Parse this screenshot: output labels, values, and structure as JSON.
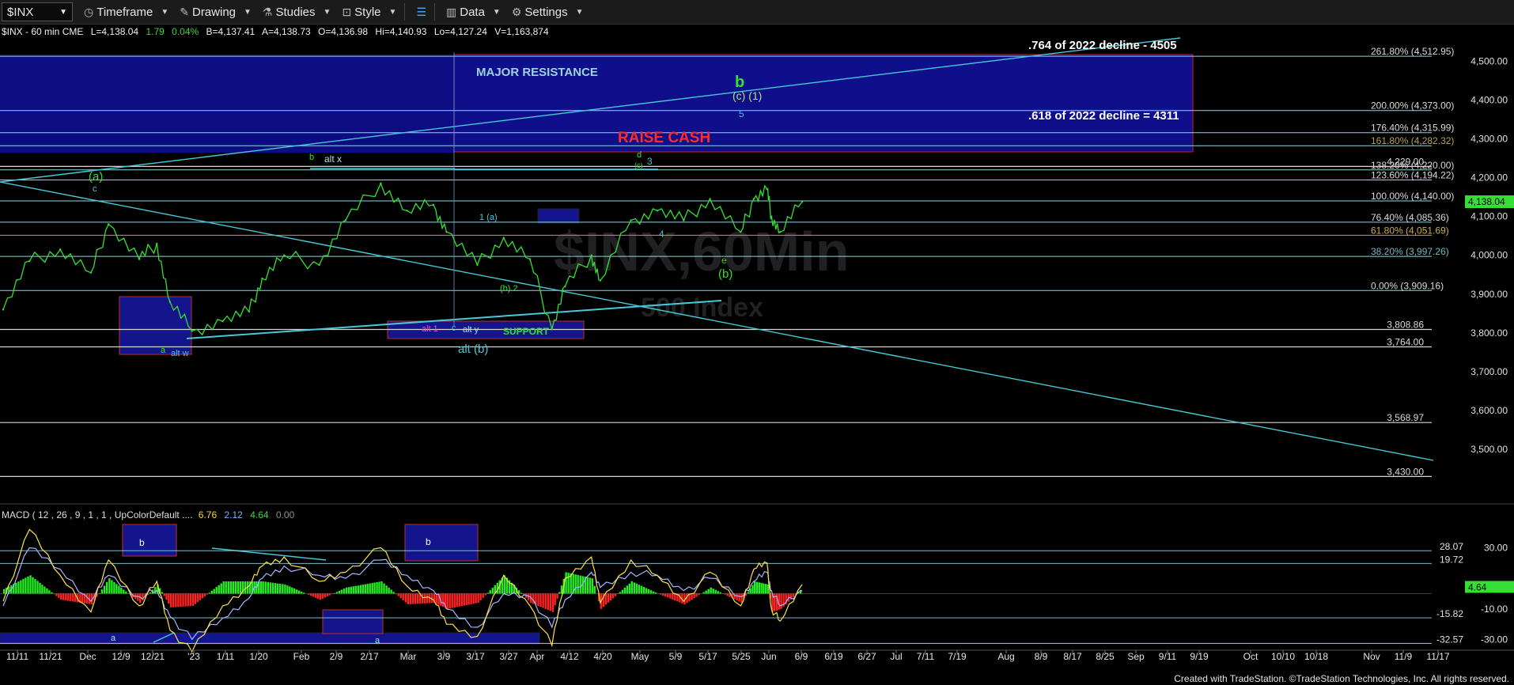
{
  "toolbar": {
    "symbol": "$INX",
    "timeframe": "Timeframe",
    "drawing": "Drawing",
    "studies": "Studies",
    "style": "Style",
    "data": "Data",
    "settings": "Settings"
  },
  "infobar": {
    "series": "$INX - 60 min CME",
    "last": "L=4,138.04",
    "change": "1.79",
    "change_pct": "0.04%",
    "bid": "B=4,137.41",
    "ask": "A=4,138.73",
    "open": "O=4,136.98",
    "high": "Hi=4,140.93",
    "low": "Lo=4,127.24",
    "volume": "V=1,163,874"
  },
  "macd_header": {
    "label": "MACD ( 12 , 26 , 9 , 1 , 1 , UpColorDefault ....",
    "v1": "6.76",
    "v2": "2.12",
    "v3": "4.64",
    "v4": "0.00"
  },
  "footer": "Created with TradeStation. ©TradeStation Technologies, Inc. All rights reserved.",
  "watermark": {
    "main": "$INX,60Min",
    "sub": "500 Index"
  },
  "colors": {
    "price_up": "#33e033",
    "macd_line": "#ffe14a",
    "signal_line": "#a8b6ff",
    "hist_up": "#22ee22",
    "hist_down": "#ff2222",
    "trendline": "#47c9d6",
    "zone": "#0f0f8c",
    "last_price_badge": "#33e033"
  },
  "chart_data": [
    {
      "type": "line",
      "title": "$INX - 60 min CME",
      "ylim": [
        3390,
        4560
      ],
      "yticks": [
        3500,
        3600,
        3700,
        3800,
        3900,
        4000,
        4100,
        4200,
        4300,
        4400,
        4500
      ],
      "ytick_labels": [
        "3,500.00",
        "3,600.00",
        "3,700.00",
        "3,800.00",
        "3,900.00",
        "4,000.00",
        "4,100.00",
        "4,200.00",
        "4,300.00",
        "4,400.00",
        "4,500.00"
      ],
      "last_price": 4138.04,
      "last_price_label": "4,138.04",
      "x_labels": [
        "11/11",
        "11/21",
        "Dec",
        "12/9",
        "12/21",
        "'23",
        "1/11",
        "1/20",
        "Feb",
        "2/9",
        "2/17",
        "Mar",
        "3/9",
        "3/17",
        "3/27",
        "Apr",
        "4/12",
        "4/20",
        "May",
        "5/9",
        "5/17",
        "5/25",
        "Jun",
        "6/9",
        "6/19",
        "6/27",
        "Jul",
        "7/11",
        "7/19",
        "Aug",
        "8/9",
        "8/17",
        "8/25",
        "Sep",
        "9/11",
        "9/19",
        "Oct",
        "10/10",
        "10/18",
        "Nov",
        "11/9",
        "11/17"
      ],
      "x": [
        "11/8",
        "11/14",
        "11/21",
        "11/28",
        "12/2",
        "12/9",
        "12/13",
        "12/16",
        "12/21",
        "12/28",
        "1/3",
        "1/6",
        "1/11",
        "1/19",
        "1/25",
        "2/2",
        "2/8",
        "2/14",
        "2/17",
        "2/24",
        "3/2",
        "3/8",
        "3/13",
        "3/16",
        "3/22",
        "3/24",
        "3/31",
        "4/6",
        "4/12",
        "4/18",
        "4/25",
        "4/28",
        "5/1",
        "5/2",
        "5/4",
        "5/9"
      ],
      "series": [
        {
          "values": [
            3860,
            3985,
            4015,
            3955,
            4080,
            3990,
            4030,
            3880,
            3805,
            3830,
            3855,
            3940,
            4000,
            3975,
            4090,
            4185,
            4115,
            4130,
            4060,
            3975,
            4045,
            3990,
            3810,
            3920,
            4000,
            3935,
            4090,
            4115,
            4090,
            4145,
            4060,
            4145,
            4170,
            4100,
            4060,
            4138
          ]
        }
      ],
      "levels": [
        {
          "value": 4512.95,
          "label": "261.80% (4,512.95)"
        },
        {
          "value": 4373,
          "label": "200.00% (4,373.00)"
        },
        {
          "value": 4315.99,
          "label": "176.40% (4,315.99)"
        },
        {
          "value": 4282.32,
          "label": "161.80% (4,282.32)"
        },
        {
          "value": 4229,
          "label": "4,229.00"
        },
        {
          "value": 4220,
          "label": "138.20% (4,220.00)"
        },
        {
          "value": 4194.22,
          "label": "123.60% (4,194.22)"
        },
        {
          "value": 4140,
          "label": "100.00% (4,140.00)"
        },
        {
          "value": 4085.36,
          "label": "76.40% (4,085.36)"
        },
        {
          "value": 4051.69,
          "label": "61.80% (4,051.69)"
        },
        {
          "value": 3997.26,
          "label": "38.20% (3,997.26)"
        },
        {
          "value": 3909.16,
          "label": "0.00% (3,909.16)"
        },
        {
          "value": 3808.86,
          "label": "3,808.86"
        },
        {
          "value": 3764,
          "label": "3,764.00"
        },
        {
          "value": 3568.97,
          "label": "3,568.97"
        },
        {
          "value": 3430,
          "label": "3,430.00"
        }
      ],
      "annotations": {
        "major_resistance": "MAJOR RESISTANCE",
        "raise_cash": "RAISE CASH",
        "support": "SUPPORT",
        "fib_764": ".764 of 2022 decline - 4505",
        "fib_618": ".618 of 2022 decline = 4311",
        "wave_b_big": "b",
        "wave_c1": "(c) (1)",
        "wave_5": "5",
        "wave_a_paren": "(a)",
        "wave_c_small": "c",
        "wave_b_feb": "b",
        "alt_x": "alt x",
        "wave_d": "d",
        "wave_c_paren_may": "(c)",
        "wave_3": "3",
        "wave_1a": "1 (a)",
        "wave_4": "4",
        "wave_e": "e",
        "wave_b_paren": "(b)",
        "wave_b2": "(b) 2",
        "wave_a_dec": "a",
        "alt_w": "alt w",
        "alt_1": "alt 1",
        "wave_c_mar": "c",
        "alt_y": "alt y",
        "alt_b_paren": "alt (b)"
      }
    },
    {
      "type": "bar",
      "title": "MACD ( 12 , 26 , 9 , 1 , 1 , UpColorDefault ....",
      "ylim": [
        -36,
        52
      ],
      "yticks": [
        30,
        -10,
        -30
      ],
      "ytick_labels": [
        "30.00",
        "-10.00",
        "-30.00"
      ],
      "levels": [
        {
          "value": 28.07,
          "label": "28.07"
        },
        {
          "value": 19.72,
          "label": "19.72"
        },
        {
          "value": -15.82,
          "label": "-15.82"
        },
        {
          "value": -32.57,
          "label": "-32.57"
        }
      ],
      "last_value": 4.64,
      "last_value_label": "4.64",
      "x": [
        "11/8",
        "11/14",
        "11/21",
        "11/28",
        "12/2",
        "12/9",
        "12/13",
        "12/16",
        "12/21",
        "12/28",
        "1/3",
        "1/6",
        "1/11",
        "1/19",
        "1/25",
        "2/2",
        "2/8",
        "2/14",
        "2/17",
        "2/24",
        "3/2",
        "3/8",
        "3/13",
        "3/16",
        "3/22",
        "3/24",
        "3/31",
        "4/6",
        "4/12",
        "4/18",
        "4/25",
        "4/28",
        "5/1",
        "5/2",
        "5/4",
        "5/9"
      ],
      "series": [
        {
          "values": [
            -5,
            42,
            12,
            -12,
            22,
            -8,
            8,
            -24,
            -38,
            -8,
            5,
            18,
            24,
            8,
            14,
            30,
            5,
            -4,
            -20,
            -28,
            12,
            -8,
            -34,
            10,
            24,
            -6,
            22,
            12,
            -5,
            14,
            -8,
            16,
            20,
            -10,
            -18,
            6
          ]
        },
        {
          "values": [
            -8,
            30,
            16,
            -5,
            12,
            -2,
            2,
            -15,
            -30,
            -16,
            -3,
            10,
            18,
            12,
            10,
            22,
            12,
            2,
            -10,
            -22,
            0,
            -2,
            -22,
            -4,
            14,
            4,
            14,
            12,
            2,
            10,
            -2,
            8,
            14,
            2,
            -8,
            2
          ]
        },
        {
          "values": [
            3,
            12,
            -4,
            -7,
            10,
            -6,
            6,
            -9,
            -8,
            8,
            8,
            8,
            6,
            -4,
            4,
            8,
            -7,
            -6,
            -10,
            -6,
            12,
            -6,
            -12,
            14,
            10,
            -10,
            8,
            0,
            -7,
            4,
            -6,
            8,
            6,
            -12,
            -10,
            4
          ]
        }
      ],
      "series_roles": [
        "macd",
        "signal",
        "histogram"
      ]
    }
  ]
}
